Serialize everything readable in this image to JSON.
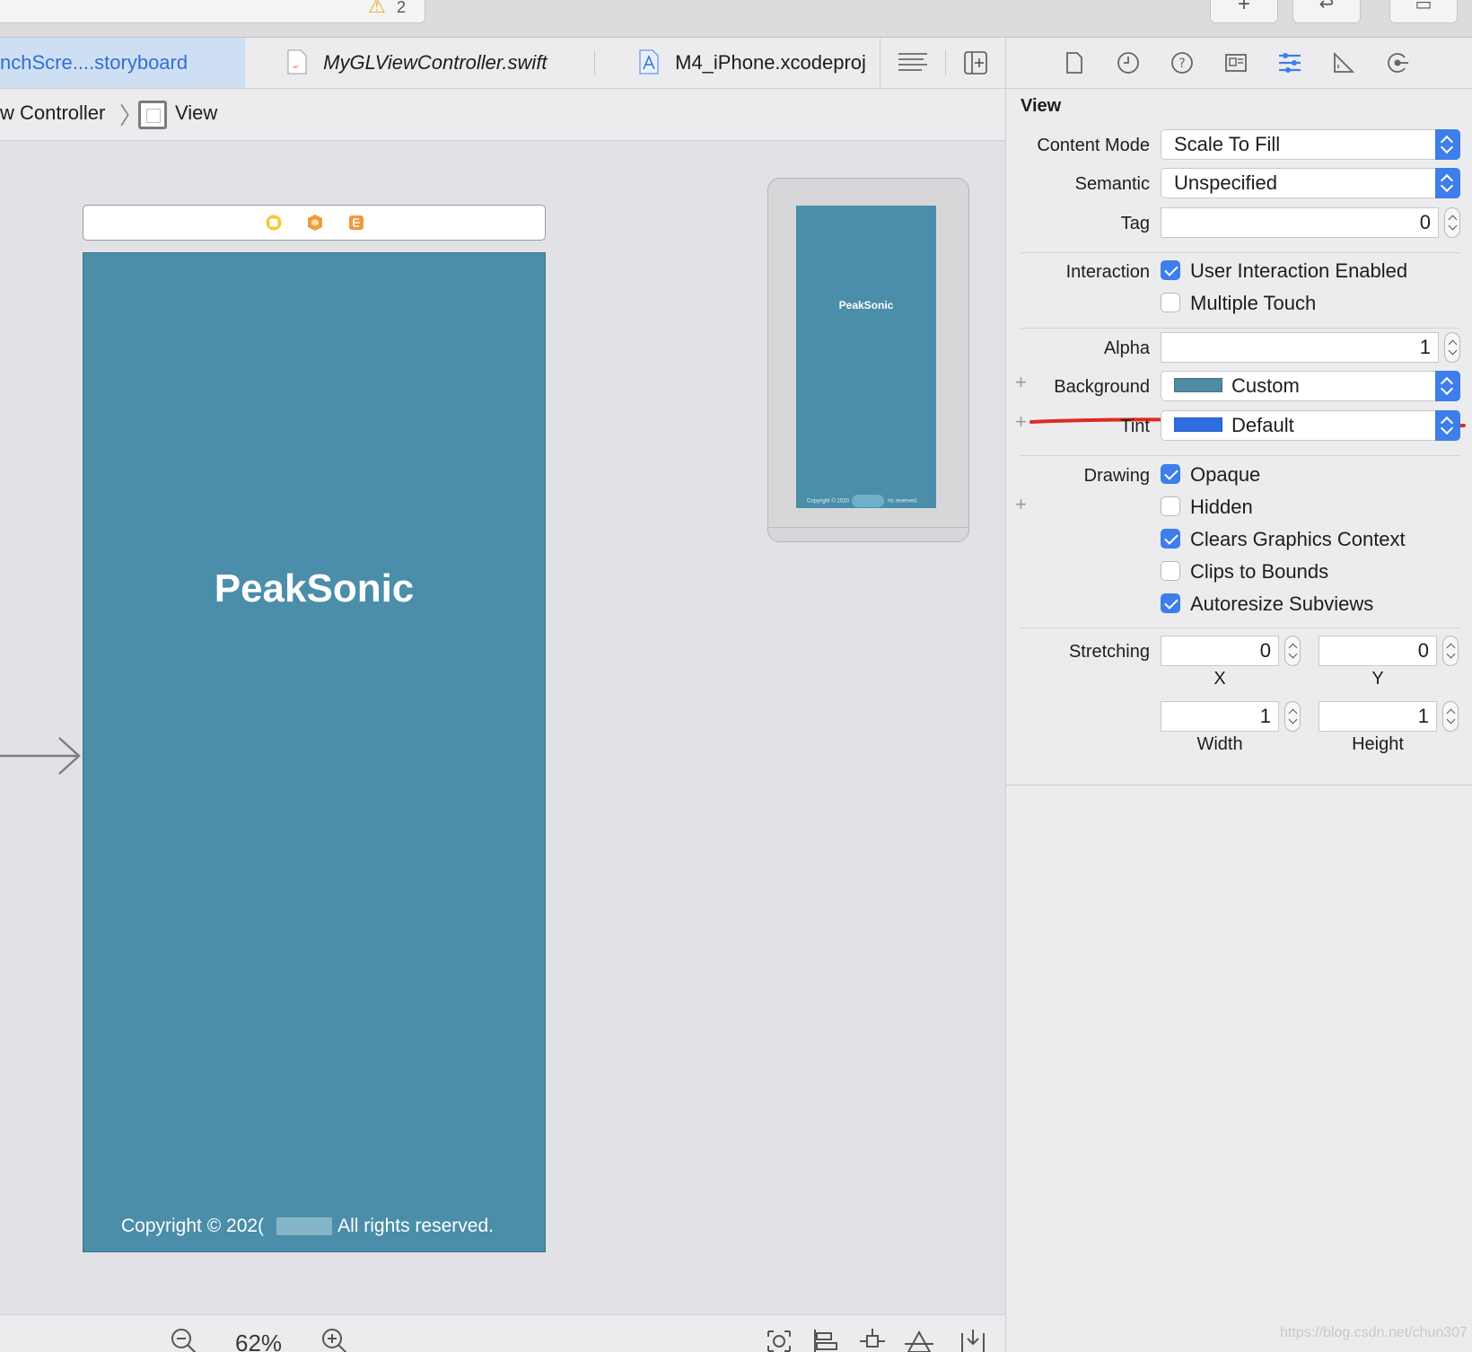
{
  "toolbar": {
    "warning_count": "2",
    "add_icon": "plus-icon",
    "back_forward_icon": "back-forward-icon",
    "panel_icon": "panel-layout-icon"
  },
  "tabs": [
    {
      "label": "nchScre....storyboard",
      "active": true,
      "icon": "storyboard-icon"
    },
    {
      "label": "MyGLViewController.swift",
      "active": false,
      "icon": "swift-file-icon"
    },
    {
      "label": "M4_iPhone.xcodeproj",
      "active": false,
      "icon": "xcodeproj-icon"
    }
  ],
  "jumpbar": {
    "crumb1": "w Controller",
    "crumb2": "View"
  },
  "canvas": {
    "scene_title": "PeakSonic",
    "copyright_prefix": "Copyright © 202(",
    "copyright_suffix": "All rights reserved.",
    "preview_title": "PeakSonic",
    "preview_copyright": "Copyright © 2020",
    "preview_copyright_suffix": "rts reserved.",
    "background_color": "#4a8ea9"
  },
  "bottombar": {
    "zoom_level": "62%"
  },
  "inspector": {
    "section_title": "View",
    "content_mode_label": "Content Mode",
    "content_mode_value": "Scale To Fill",
    "semantic_label": "Semantic",
    "semantic_value": "Unspecified",
    "tag_label": "Tag",
    "tag_value": "0",
    "interaction_label": "Interaction",
    "user_interaction_label": "User Interaction Enabled",
    "user_interaction_checked": true,
    "multiple_touch_label": "Multiple Touch",
    "multiple_touch_checked": false,
    "alpha_label": "Alpha",
    "alpha_value": "1",
    "background_label": "Background",
    "background_value": "Custom",
    "background_swatch": "#4f8aa3",
    "tint_label": "Tint",
    "tint_value": "Default",
    "tint_swatch": "#2e6ee0",
    "drawing_label": "Drawing",
    "opaque_label": "Opaque",
    "opaque_checked": true,
    "hidden_label": "Hidden",
    "hidden_checked": false,
    "clears_label": "Clears Graphics Context",
    "clears_checked": true,
    "clips_label": "Clips to Bounds",
    "clips_checked": false,
    "autoresize_label": "Autoresize Subviews",
    "autoresize_checked": true,
    "stretching_label": "Stretching",
    "stretch_x": "0",
    "stretch_y": "0",
    "stretch_width": "1",
    "stretch_height": "1",
    "x_label": "X",
    "y_label": "Y",
    "width_label": "Width",
    "height_label": "Height",
    "accent_color": "#3d7eea",
    "annotation_color": "#e02a1f"
  },
  "watermark": "https://blog.csdn.net/chun307"
}
